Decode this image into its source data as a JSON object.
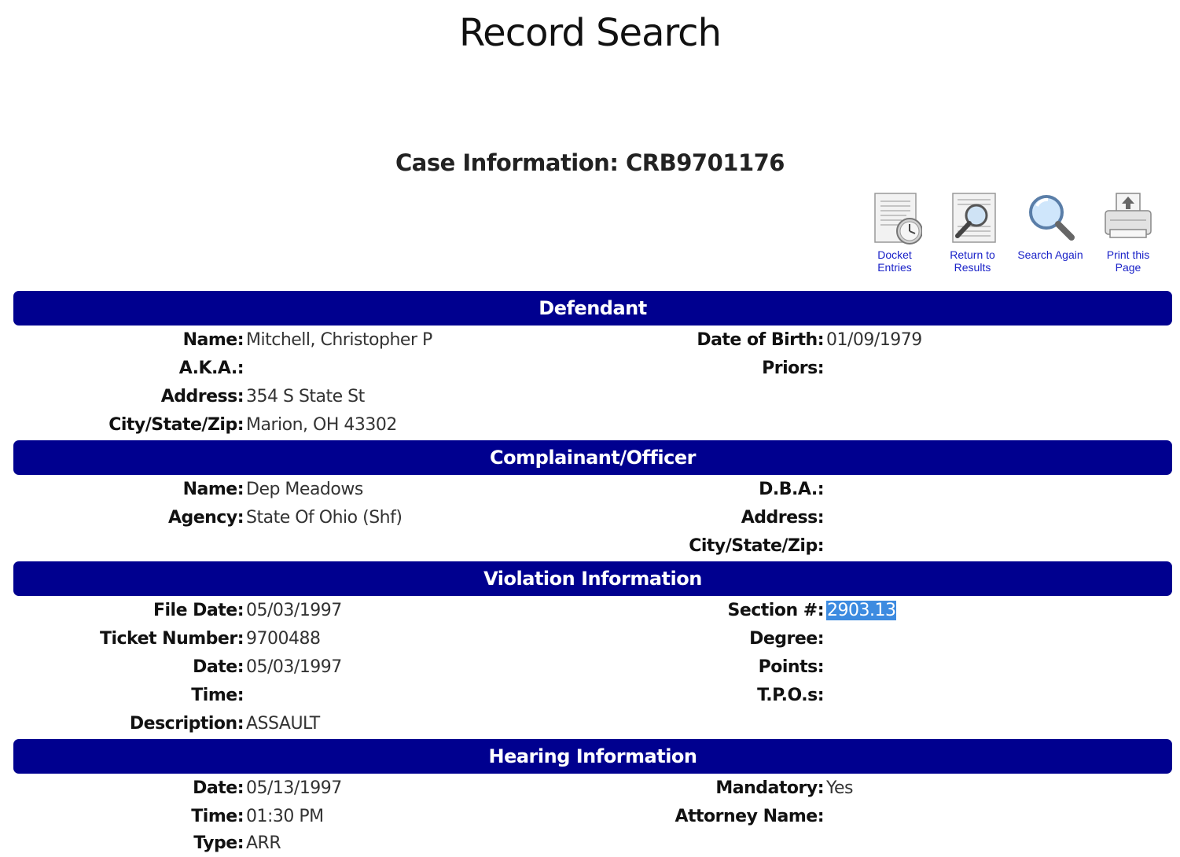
{
  "page": {
    "title": "Record Search",
    "case_title": "Case Information: CRB9701176"
  },
  "toolbar": {
    "docket": "Docket\nEntries",
    "docket_l1": "Docket",
    "docket_l2": "Entries",
    "return_l1": "Return to",
    "return_l2": "Results",
    "search_l1": "Search Again",
    "print_l1": "Print this",
    "print_l2": "Page",
    "icons": [
      "docket-icon",
      "return-results-icon",
      "magnifier-icon",
      "printer-icon"
    ]
  },
  "sections": {
    "defendant": "Defendant",
    "complainant": "Complainant/Officer",
    "violation": "Violation Information",
    "hearing": "Hearing Information"
  },
  "defendant": {
    "name_label": "Name:",
    "name": "Mitchell, Christopher P",
    "aka_label": "A.K.A.:",
    "address_label": "Address:",
    "address": "354 S State St",
    "csz_label": "City/State/Zip:",
    "csz": "Marion, OH 43302",
    "dob_label": "Date of Birth:",
    "dob": "01/09/1979",
    "priors_label": "Priors:"
  },
  "complainant": {
    "name_label": "Name:",
    "name": "Dep Meadows",
    "agency_label": "Agency:",
    "agency": "State Of Ohio (Shf)",
    "dba_label": "D.B.A.:",
    "address_label": "Address:",
    "csz_label": "City/State/Zip:"
  },
  "violation": {
    "file_date_label": "File Date:",
    "file_date": "05/03/1997",
    "ticket_label": "Ticket Number:",
    "ticket": "9700488",
    "date_label": "Date:",
    "date": "05/03/1997",
    "time_label": "Time:",
    "desc_label": "Description:",
    "desc": "ASSAULT",
    "section_label": "Section #:",
    "section": "2903.13",
    "degree_label": "Degree:",
    "points_label": "Points:",
    "tpos_label": "T.P.O.s:"
  },
  "hearing": {
    "date_label": "Date:",
    "date": "05/13/1997",
    "time_label": "Time:",
    "time": "01:30 PM",
    "type_label": "Type:",
    "type": "ARR",
    "mandatory_label": "Mandatory:",
    "mandatory": "Yes",
    "attorney_label": "Attorney Name:"
  },
  "colors": {
    "section_bar": "#00008f",
    "link": "#1a22c8",
    "selection": "#3d8be0"
  }
}
